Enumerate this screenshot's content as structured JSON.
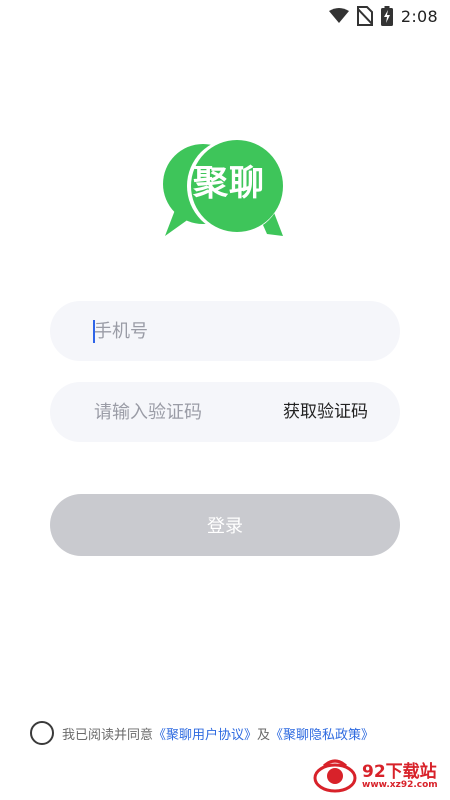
{
  "status_bar": {
    "time": "2:08",
    "icons": [
      "wifi-icon",
      "no-sim-icon",
      "battery-charging-icon"
    ]
  },
  "logo": {
    "text": "聚聊",
    "color": "#3ec55a",
    "shade_color": "#2fae4a"
  },
  "form": {
    "phone_placeholder": "手机号",
    "code_placeholder": "请输入验证码",
    "get_code_label": "获取验证码",
    "login_label": "登录"
  },
  "agreement": {
    "prefix": "我已阅读并同意",
    "user_agreement": "《聚聊用户协议》",
    "and": "及",
    "privacy_policy": "《聚聊隐私政策》"
  },
  "watermark": {
    "text": "92下载站",
    "url": "www.xz92.com"
  },
  "colors": {
    "accent": "#3ec55a",
    "link": "#2f6be0",
    "button_disabled": "#c9cacf",
    "input_bg": "#f5f6fa"
  }
}
